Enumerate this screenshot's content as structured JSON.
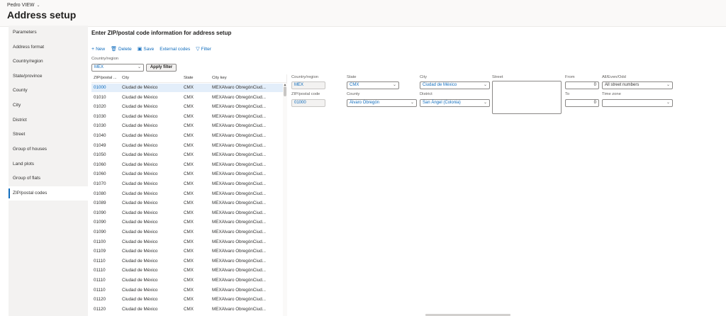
{
  "header": {
    "breadcrumb": "Pedro VIEW",
    "title": "Address setup"
  },
  "sidebar": {
    "items": [
      {
        "label": "Parameters"
      },
      {
        "label": "Address format"
      },
      {
        "label": "Country/region"
      },
      {
        "label": "State/province"
      },
      {
        "label": "County"
      },
      {
        "label": "City"
      },
      {
        "label": "District"
      },
      {
        "label": "Street"
      },
      {
        "label": "Group of houses"
      },
      {
        "label": "Land plots"
      },
      {
        "label": "Group of flats"
      },
      {
        "label": "ZIP/postal codes"
      }
    ],
    "selected": "ZIP/postal codes"
  },
  "main": {
    "section_title": "Enter ZIP/postal code information for address setup",
    "toolbar": {
      "new": "New",
      "delete": "Delete",
      "save": "Save",
      "external_codes": "External codes",
      "filter": "Filter"
    },
    "filter": {
      "country_label": "Country/region",
      "country_value": "MEX",
      "apply_label": "Apply filter"
    },
    "grid": {
      "columns": [
        "ZIP/postal ...",
        "City",
        "State",
        "City key"
      ],
      "rows": [
        [
          "01000",
          "Ciudad de México",
          "CMX",
          "MEXÁlvaro ObregónCiud..."
        ],
        [
          "01010",
          "Ciudad de México",
          "CMX",
          "MEXÁlvaro ObregónCiud..."
        ],
        [
          "01020",
          "Ciudad de México",
          "CMX",
          "MEXÁlvaro ObregónCiud..."
        ],
        [
          "01030",
          "Ciudad de México",
          "CMX",
          "MEXÁlvaro ObregónCiud..."
        ],
        [
          "01030",
          "Ciudad de México",
          "CMX",
          "MEXÁlvaro ObregónCiud..."
        ],
        [
          "01040",
          "Ciudad de México",
          "CMX",
          "MEXÁlvaro ObregónCiud..."
        ],
        [
          "01049",
          "Ciudad de México",
          "CMX",
          "MEXÁlvaro ObregónCiud..."
        ],
        [
          "01050",
          "Ciudad de México",
          "CMX",
          "MEXÁlvaro ObregónCiud..."
        ],
        [
          "01060",
          "Ciudad de México",
          "CMX",
          "MEXÁlvaro ObregónCiud..."
        ],
        [
          "01060",
          "Ciudad de México",
          "CMX",
          "MEXÁlvaro ObregónCiud..."
        ],
        [
          "01070",
          "Ciudad de México",
          "CMX",
          "MEXÁlvaro ObregónCiud..."
        ],
        [
          "01080",
          "Ciudad de México",
          "CMX",
          "MEXÁlvaro ObregónCiud..."
        ],
        [
          "01089",
          "Ciudad de México",
          "CMX",
          "MEXÁlvaro ObregónCiud..."
        ],
        [
          "01090",
          "Ciudad de México",
          "CMX",
          "MEXÁlvaro ObregónCiud..."
        ],
        [
          "01090",
          "Ciudad de México",
          "CMX",
          "MEXÁlvaro ObregónCiud..."
        ],
        [
          "01090",
          "Ciudad de México",
          "CMX",
          "MEXÁlvaro ObregónCiud..."
        ],
        [
          "01100",
          "Ciudad de México",
          "CMX",
          "MEXÁlvaro ObregónCiud..."
        ],
        [
          "01109",
          "Ciudad de México",
          "CMX",
          "MEXÁlvaro ObregónCiud..."
        ],
        [
          "01110",
          "Ciudad de México",
          "CMX",
          "MEXÁlvaro ObregónCiud..."
        ],
        [
          "01110",
          "Ciudad de México",
          "CMX",
          "MEXÁlvaro ObregónCiud..."
        ],
        [
          "01110",
          "Ciudad de México",
          "CMX",
          "MEXÁlvaro ObregónCiud..."
        ],
        [
          "01110",
          "Ciudad de México",
          "CMX",
          "MEXÁlvaro ObregónCiud..."
        ],
        [
          "01120",
          "Ciudad de México",
          "CMX",
          "MEXÁlvaro ObregónCiud..."
        ],
        [
          "01120",
          "Ciudad de México",
          "CMX",
          "MEXÁlvaro ObregónCiud..."
        ]
      ]
    },
    "details": {
      "country_label": "Country/region",
      "country_value": "MEX",
      "zip_label": "ZIP/postal code",
      "zip_value": "01000",
      "state_label": "State",
      "state_value": "CMX",
      "county_label": "County",
      "county_value": "Álvaro Obregón",
      "city_label": "City",
      "city_value": "Ciudad de México",
      "district_label": "District",
      "district_value": "San Ángel (Colonia)",
      "street_label": "Street",
      "street_value": "",
      "from_label": "From",
      "from_value": "0",
      "to_label": "To",
      "to_value": "0",
      "allevenodd_label": "All/Even/Odd",
      "allevenodd_value": "All street numbers",
      "timezone_label": "Time zone",
      "timezone_value": ""
    }
  },
  "colors": {
    "accent": "#0f6cbd",
    "selected_row": "#e3eefa",
    "sidebar_bg": "#f3f2f1"
  }
}
